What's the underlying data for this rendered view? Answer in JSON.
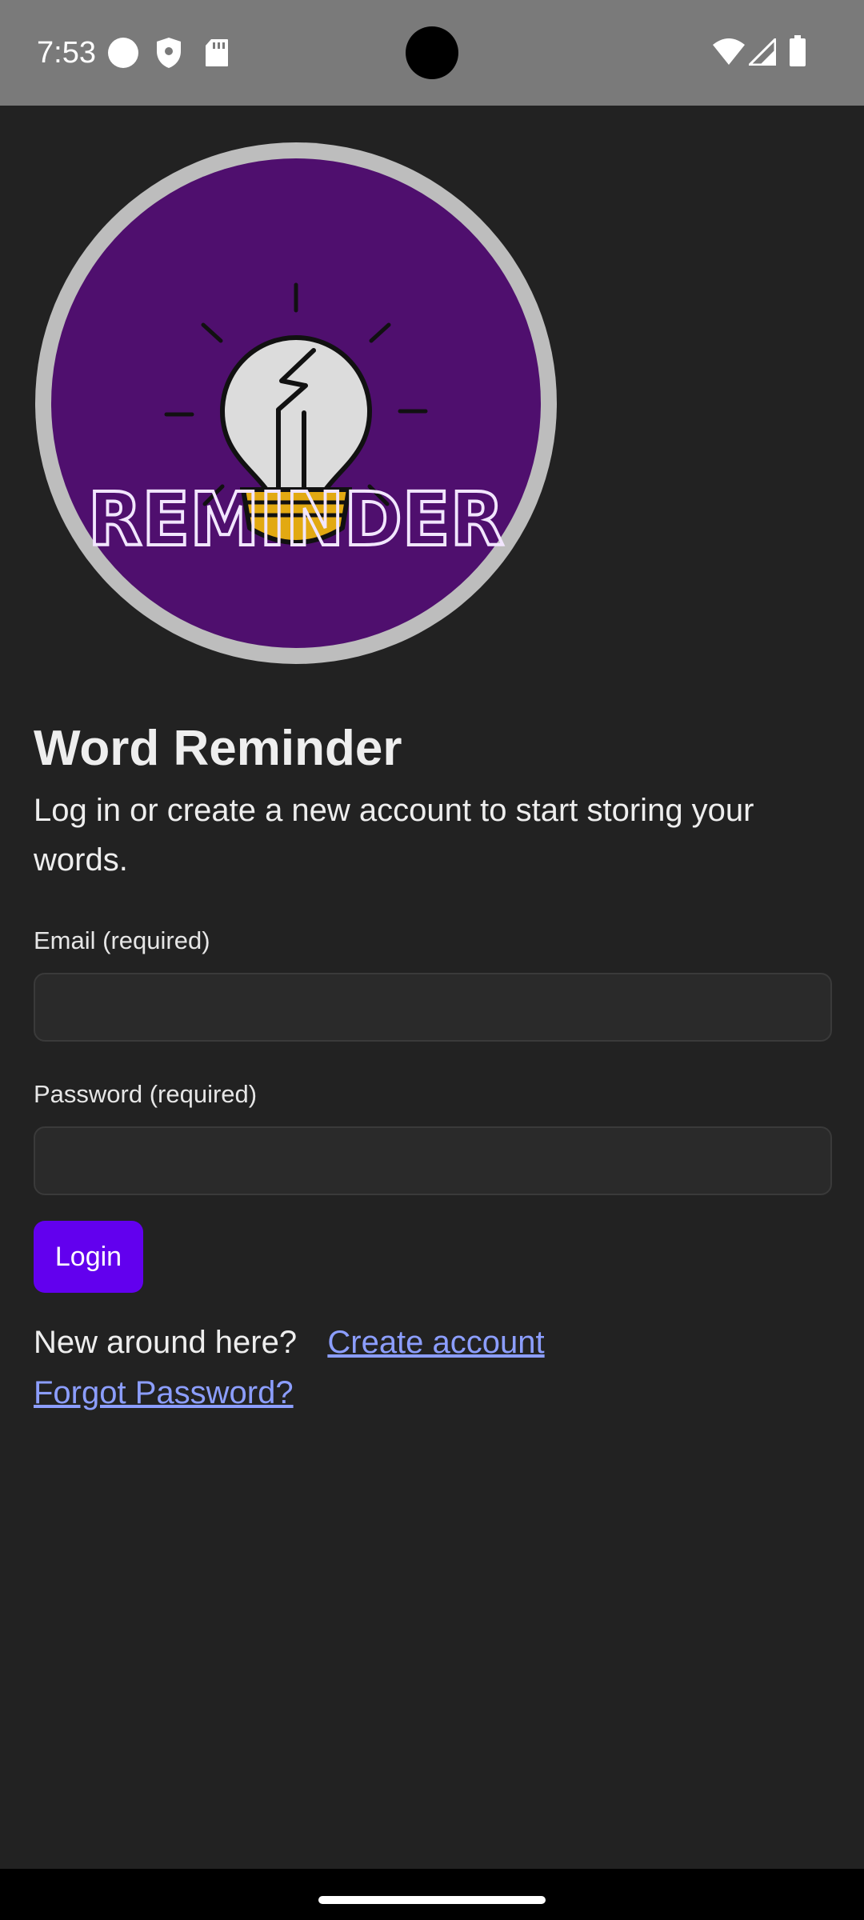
{
  "status_bar": {
    "time": "7:53",
    "left_icons": [
      "circle-notification-icon",
      "shield-icon",
      "sd-card-icon"
    ],
    "right_icons": [
      "wifi-icon",
      "cellular-signal-icon",
      "battery-icon"
    ]
  },
  "logo": {
    "text": "REMINDER",
    "colors": {
      "ring": "#bdbdbd",
      "background": "#4f0f6e",
      "bulb": "#dcdcdc",
      "bulb_base": "#e2a912"
    }
  },
  "page": {
    "title": "Word Reminder",
    "subtitle": "Log in or create a new account to start storing your words."
  },
  "form": {
    "email_label": "Email (required)",
    "email_value": "",
    "password_label": "Password (required)",
    "password_value": "",
    "login_label": "Login"
  },
  "links": {
    "new_prompt": "New around here?",
    "create_account": "Create account",
    "forgot_password": "Forgot Password?"
  },
  "colors": {
    "background": "#222222",
    "accent": "#6200ee",
    "link": "#8c9eff"
  }
}
